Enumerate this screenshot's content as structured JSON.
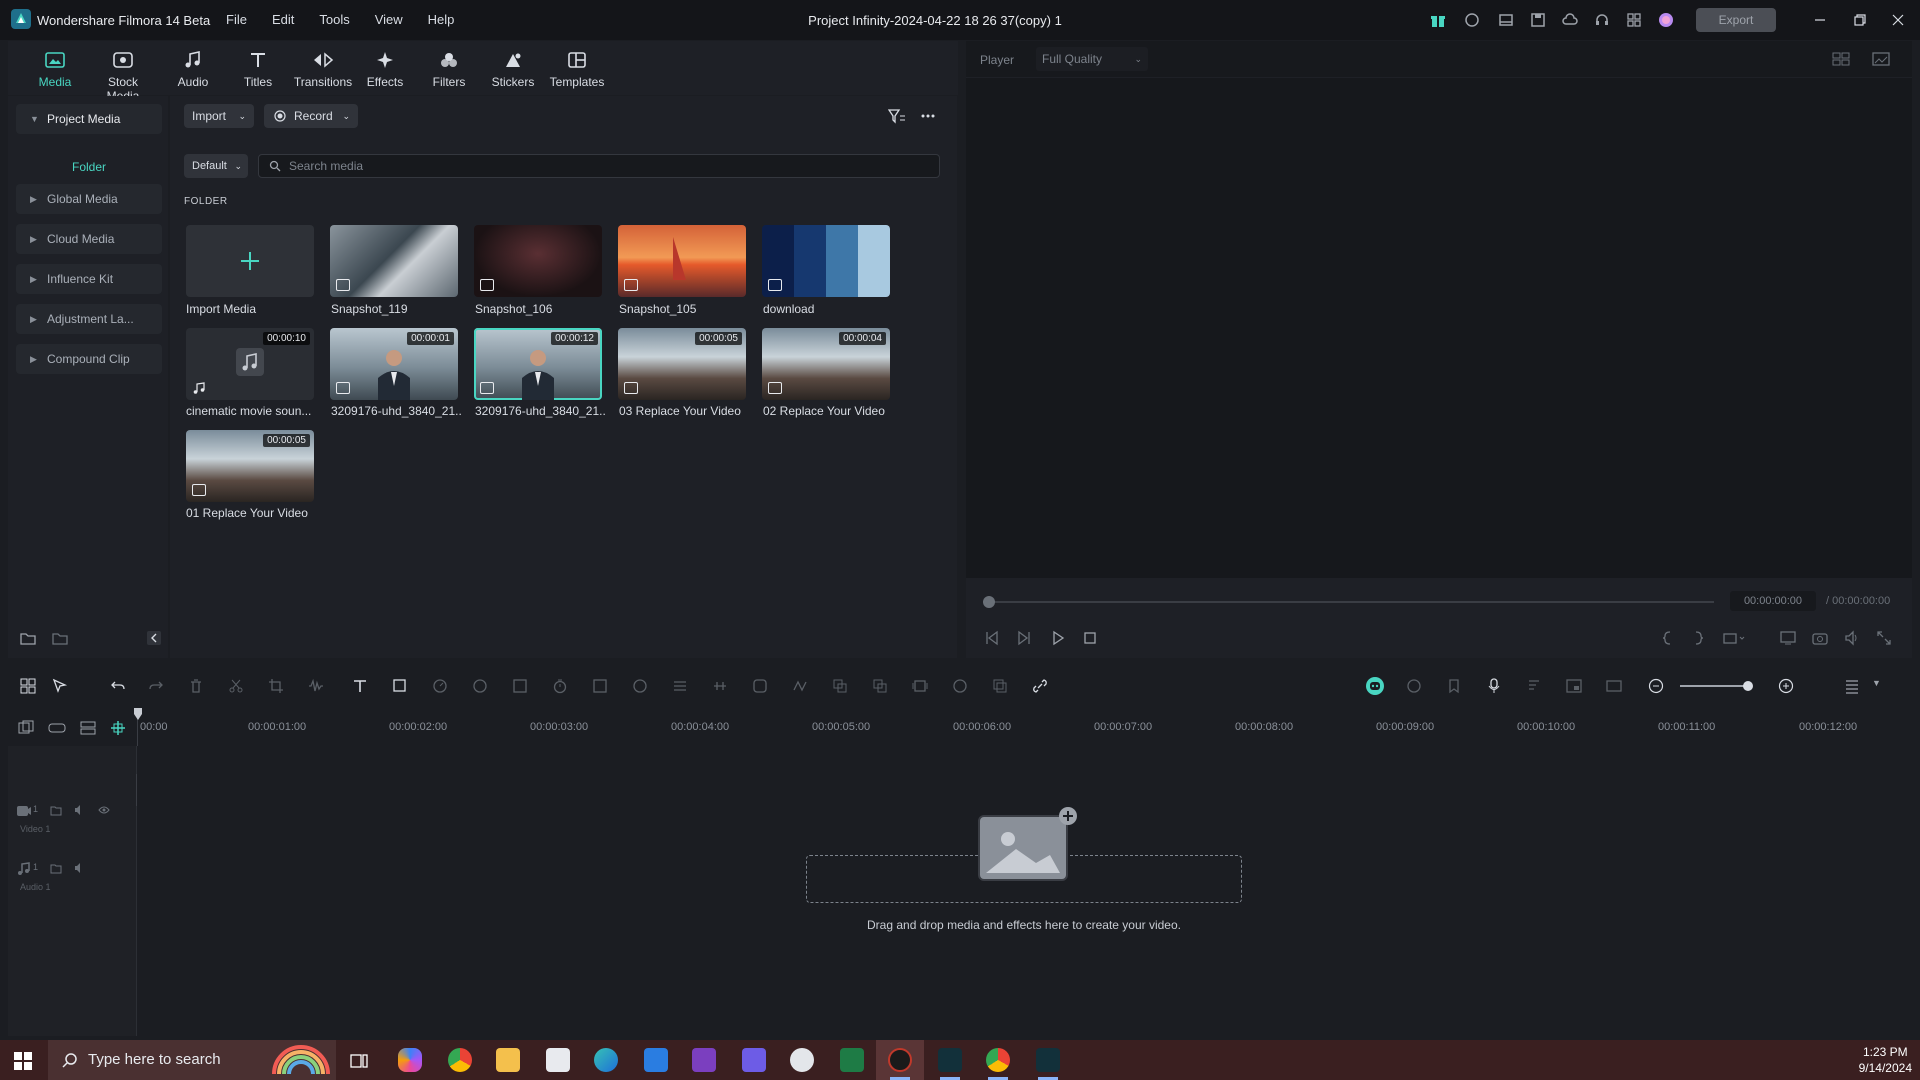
{
  "app": {
    "name": "Wondershare Filmora 14 Beta",
    "project_title": "Project Infinity-2024-04-22 18 26 37(copy) 1",
    "export_label": "Export"
  },
  "menu": [
    "File",
    "Edit",
    "Tools",
    "View",
    "Help"
  ],
  "tabs": [
    "Media",
    "Stock Media",
    "Audio",
    "Titles",
    "Transitions",
    "Effects",
    "Filters",
    "Stickers",
    "Templates"
  ],
  "nav": {
    "project_media": "Project Media",
    "folder": "Folder",
    "items": [
      "Global Media",
      "Cloud Media",
      "Influence Kit",
      "Adjustment La...",
      "Compound Clip"
    ]
  },
  "media_toolbar": {
    "import": "Import",
    "record": "Record",
    "sort": "Default",
    "search_placeholder": "Search media",
    "folder_label": "FOLDER"
  },
  "media_items": [
    {
      "label": "Import Media",
      "duration": ""
    },
    {
      "label": "Snapshot_119",
      "duration": ""
    },
    {
      "label": "Snapshot_106",
      "duration": ""
    },
    {
      "label": "Snapshot_105",
      "duration": ""
    },
    {
      "label": "download",
      "duration": ""
    },
    {
      "label": "cinematic movie soun...",
      "duration": "00:00:10"
    },
    {
      "label": "3209176-uhd_3840_21...",
      "duration": "00:00:01"
    },
    {
      "label": "3209176-uhd_3840_21...",
      "duration": "00:00:12"
    },
    {
      "label": "03 Replace Your Video",
      "duration": "00:00:05"
    },
    {
      "label": "02 Replace Your Video",
      "duration": "00:00:04"
    },
    {
      "label": "01 Replace Your Video",
      "duration": "00:00:05"
    }
  ],
  "player": {
    "label": "Player",
    "quality": "Full Quality",
    "current_time": "00:00:00:00",
    "total_time": "/ 00:00:00:00"
  },
  "timeline": {
    "ruler": [
      "00:00",
      "00:00:01:00",
      "00:00:02:00",
      "00:00:03:00",
      "00:00:04:00",
      "00:00:05:00",
      "00:00:06:00",
      "00:00:07:00",
      "00:00:08:00",
      "00:00:09:00",
      "00:00:10:00",
      "00:00:11:00",
      "00:00:12:00"
    ],
    "tracks": [
      {
        "num": "1",
        "name": "Video 1"
      },
      {
        "num": "1",
        "name": "Audio 1"
      }
    ],
    "drop_hint": "Drag and drop media and effects here to create your video."
  },
  "taskbar": {
    "search_placeholder": "Type here to search",
    "time": "1:23 PM",
    "date": "9/14/2024"
  },
  "colors": {
    "accent": "#49d6c2",
    "bg": "#1b1d22",
    "panel": "#1e2026",
    "taskbar": "#3a1f20"
  }
}
